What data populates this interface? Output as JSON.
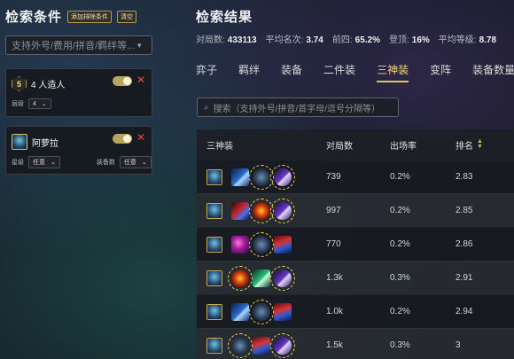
{
  "filter_panel": {
    "title": "检索条件",
    "add_remove_button": "添加排除条件",
    "clear_button": "清空",
    "search_placeholder": "支持外号/费用/拼音/羁绊等...",
    "conditions": [
      {
        "type": "trait",
        "icon_text": "5",
        "name": "4 人造人",
        "level_label": "层级",
        "level_value": "4",
        "enabled": true
      },
      {
        "type": "champion",
        "name": "阿萝拉",
        "star_label": "星级",
        "star_value": "任意",
        "items_label": "装备数",
        "items_value": "任意",
        "enabled": true
      }
    ]
  },
  "results": {
    "title": "检索结果",
    "stats": [
      {
        "label": "对局数:",
        "value": "433113"
      },
      {
        "label": "平均名次:",
        "value": "3.74"
      },
      {
        "label": "前四:",
        "value": "65.2%"
      },
      {
        "label": "登顶:",
        "value": "16%"
      },
      {
        "label": "平均等级:",
        "value": "8.78"
      }
    ],
    "tabs": [
      "弈子",
      "羁绊",
      "装备",
      "二件装",
      "三神装",
      "变阵",
      "装备数量"
    ],
    "active_tab": "三神装",
    "search_placeholder": "搜索（支持外号/拼音/首字母/逗号分隔等）",
    "table": {
      "headers": [
        "三神装",
        "对局数",
        "出场率",
        "排名"
      ],
      "rows": [
        {
          "items": [
            "blue-sword",
            "sword-break",
            "purple-spear"
          ],
          "rings": [
            false,
            true,
            true
          ],
          "games": "739",
          "rate": "0.2%",
          "rank": "2.83"
        },
        {
          "items": [
            "red-gauntlet",
            "eye",
            "purple-spear"
          ],
          "rings": [
            false,
            true,
            true
          ],
          "games": "997",
          "rate": "0.2%",
          "rank": "2.85"
        },
        {
          "items": [
            "violet",
            "sword-break",
            "redblue"
          ],
          "rings": [
            false,
            true,
            false
          ],
          "games": "770",
          "rate": "0.2%",
          "rank": "2.86"
        },
        {
          "items": [
            "eye",
            "green",
            "purple-spear"
          ],
          "rings": [
            true,
            false,
            true
          ],
          "games": "1.3k",
          "rate": "0.3%",
          "rank": "2.91"
        },
        {
          "items": [
            "blue-sword",
            "sword-break",
            "redblue"
          ],
          "rings": [
            false,
            true,
            false
          ],
          "games": "1.0k",
          "rate": "0.2%",
          "rank": "2.94"
        },
        {
          "items": [
            "sword-break",
            "redblue",
            "purple-spear"
          ],
          "rings": [
            true,
            false,
            true
          ],
          "games": "1.5k",
          "rate": "0.3%",
          "rank": "3"
        }
      ]
    }
  },
  "colors": {
    "accent": "#e3c45c",
    "remove": "#e34848"
  }
}
